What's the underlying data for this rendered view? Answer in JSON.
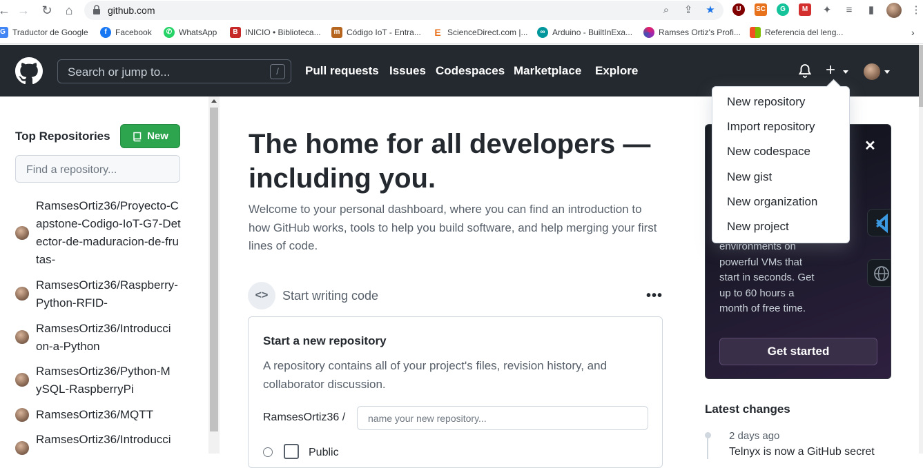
{
  "browser": {
    "url": "github.com",
    "bookmarks": [
      "Traductor de Google",
      "Facebook",
      "WhatsApp",
      "INICIO • Biblioteca...",
      "Código IoT - Entra...",
      "ScienceDirect.com |...",
      "Arduino - BuiltInExa...",
      "Ramses Ortiz's Profi...",
      "Referencia del leng..."
    ]
  },
  "header": {
    "search_placeholder": "Search or jump to...",
    "search_shortcut": "/",
    "nav": [
      "Pull requests",
      "Issues",
      "Codespaces",
      "Marketplace",
      "Explore"
    ]
  },
  "sidebar": {
    "title": "Top Repositories",
    "new_label": "New",
    "find_placeholder": "Find a repository...",
    "repos": [
      "RamsesOrtiz36/Proyecto-Capstone-Codigo-IoT-G7-Detector-de-maduracion-de-frutas-",
      "RamsesOrtiz36/Raspberry-Python-RFID-",
      "RamsesOrtiz36/Introduccion-a-Python",
      "RamsesOrtiz36/Python-MySQL-RaspberryPi",
      "RamsesOrtiz36/MQTT",
      "RamsesOrtiz36/Introducci"
    ]
  },
  "main": {
    "title": "The home for all developers — including you.",
    "subtitle": "Welcome to your personal dashboard, where you can find an introduction to how GitHub works, tools to help you build software, and help merging your first lines of code.",
    "start_writing": "Start writing code",
    "card": {
      "title": "Start a new repository",
      "description": "A repository contains all of your project's files, revision history, and collaborator discussion.",
      "owner": "RamsesOrtiz36 /",
      "name_placeholder": "name your new repository...",
      "visibility": "Public"
    }
  },
  "promo": {
    "text": "environments on powerful VMs that start in seconds. Get up to 60 hours a month of free time.",
    "button": "Get started"
  },
  "latest": {
    "title": "Latest changes",
    "date": "2 days ago",
    "item": "Telnyx is now a GitHub secret"
  },
  "dropdown": {
    "items": [
      "New repository",
      "Import repository",
      "New codespace",
      "New gist",
      "New organization",
      "New project"
    ]
  }
}
